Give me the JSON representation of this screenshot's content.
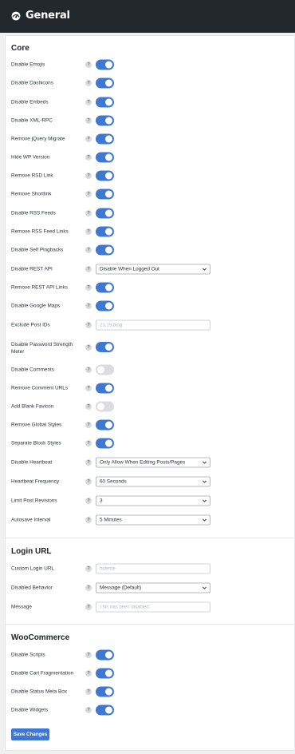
{
  "header": {
    "title": "General",
    "icon": "dashboard-gauge-icon"
  },
  "colors": {
    "accent": "#3f78d0",
    "header_bg": "#23282d",
    "toggle_off": "#dcdcde"
  },
  "sections": {
    "core": {
      "title": "Core"
    },
    "login_url": {
      "title": "Login URL"
    },
    "woocommerce": {
      "title": "WooCommerce"
    }
  },
  "core": {
    "disable_emojis": {
      "label": "Disable Emojis",
      "enabled": true
    },
    "disable_dashicons": {
      "label": "Disable Dashicons",
      "enabled": true
    },
    "disable_embeds": {
      "label": "Disable Embeds",
      "enabled": true
    },
    "disable_xml_rpc": {
      "label": "Disable XML-RPC",
      "enabled": true
    },
    "remove_jquery_migrate": {
      "label": "Remove jQuery Migrate",
      "enabled": true
    },
    "hide_wp_version": {
      "label": "Hide WP Version",
      "enabled": true
    },
    "remove_rsd_link": {
      "label": "Remove RSD Link",
      "enabled": true
    },
    "remove_shortlink": {
      "label": "Remove Shortlink",
      "enabled": true
    },
    "disable_rss_feeds": {
      "label": "Disable RSS Feeds",
      "enabled": true
    },
    "remove_rss_feed_links": {
      "label": "Remove RSS Feed Links",
      "enabled": true
    },
    "disable_self_pingbacks": {
      "label": "Disable Self Pingbacks",
      "enabled": true
    },
    "disable_rest_api": {
      "label": "Disable REST API",
      "value": "Disable When Logged Out"
    },
    "remove_rest_api_links": {
      "label": "Remove REST API Links",
      "enabled": true
    },
    "disable_google_maps": {
      "label": "Disable Google Maps",
      "enabled": true
    },
    "exclude_post_ids": {
      "label": "Exclude Post IDs",
      "value": "",
      "placeholder": "23,19,blog"
    },
    "disable_password_strength_meter": {
      "label": "Disable Password Strength Meter",
      "enabled": true
    },
    "disable_comments": {
      "label": "Disable Comments",
      "enabled": false
    },
    "remove_comment_urls": {
      "label": "Remove Comment URLs",
      "enabled": true
    },
    "add_blank_favicon": {
      "label": "Add Blank Favicon",
      "enabled": false
    },
    "remove_global_styles": {
      "label": "Remove Global Styles",
      "enabled": true
    },
    "separate_block_styles": {
      "label": "Separate Block Styles",
      "enabled": true
    },
    "disable_heartbeat": {
      "label": "Disable Heartbeat",
      "value": "Only Allow When Editing Posts/Pages"
    },
    "heartbeat_frequency": {
      "label": "Heartbeat Frequency",
      "value": "60 Seconds"
    },
    "limit_post_revisions": {
      "label": "Limit Post Revisions",
      "value": "3"
    },
    "autosave_interval": {
      "label": "Autosave Interval",
      "value": "5 Minutes"
    }
  },
  "login_url": {
    "custom_login_url": {
      "label": "Custom Login URL",
      "value": "",
      "placeholder": "hideme"
    },
    "disabled_behavior": {
      "label": "Disabled Behavior",
      "value": "Message (Default)"
    },
    "message": {
      "label": "Message",
      "value": "",
      "placeholder": "This has been disabled."
    }
  },
  "woocommerce": {
    "disable_scripts": {
      "label": "Disable Scripts",
      "enabled": true
    },
    "disable_cart_fragmentation": {
      "label": "Disable Cart Fragmentation",
      "enabled": true
    },
    "disable_status_meta_box": {
      "label": "Disable Status Meta Box",
      "enabled": true
    },
    "disable_widgets": {
      "label": "Disable Widgets",
      "enabled": true
    }
  },
  "help_glyph": "?",
  "save_button": {
    "label": "Save Changes"
  }
}
